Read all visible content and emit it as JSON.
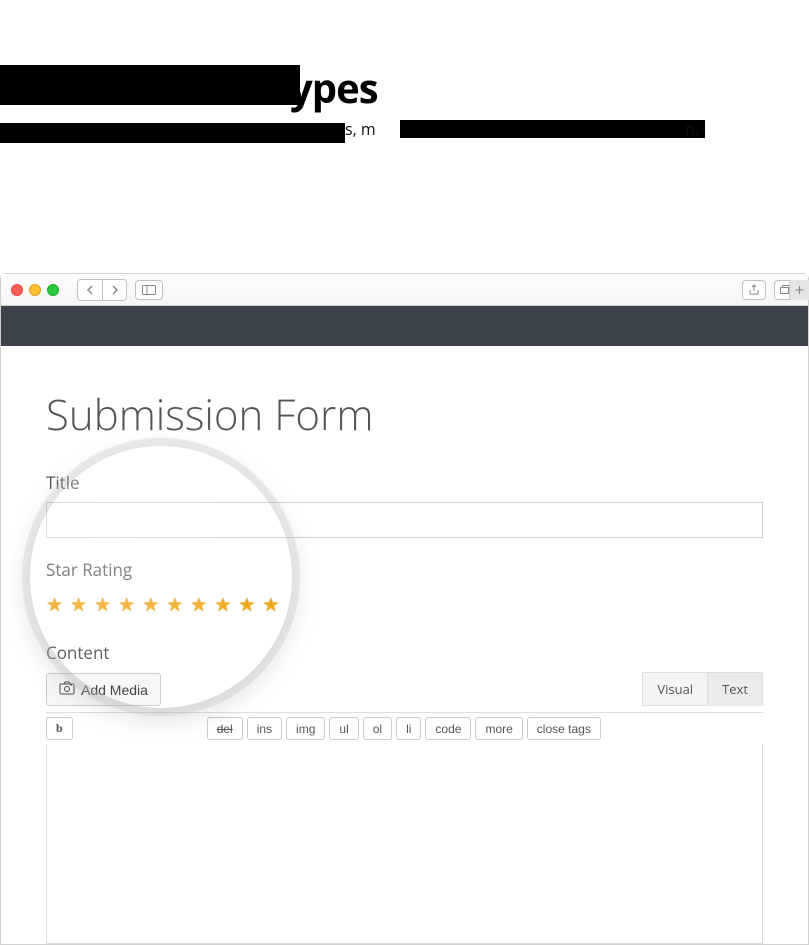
{
  "header": {
    "title_fragment": "ypes",
    "subtitle_fragment_1": "s, m",
    "subtitle_fragment_2": "n."
  },
  "form": {
    "page_title": "Submission Form",
    "title_label": "Title",
    "title_value": "",
    "rating_label": "Star Rating",
    "stars_count": 10,
    "content_label": "Content",
    "add_media_label": "Add Media",
    "tabs": {
      "visual": "Visual",
      "text": "Text"
    },
    "toolbar": [
      "b",
      "del",
      "ins",
      "img",
      "ul",
      "ol",
      "li",
      "code",
      "more",
      "close tags"
    ]
  }
}
